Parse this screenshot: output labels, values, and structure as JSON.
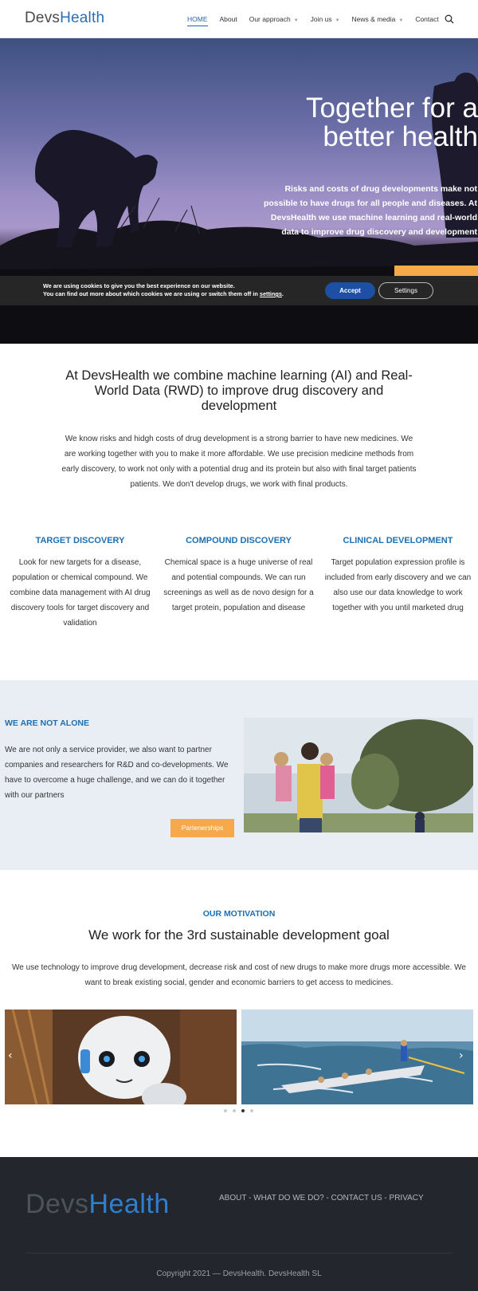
{
  "header": {
    "logo": {
      "part1": "Devs",
      "part2": "Health"
    },
    "nav": [
      {
        "label": "HOME",
        "active": true,
        "dropdown": false
      },
      {
        "label": "About",
        "active": false,
        "dropdown": false
      },
      {
        "label": "Our approach",
        "active": false,
        "dropdown": true
      },
      {
        "label": "Join us",
        "active": false,
        "dropdown": true
      },
      {
        "label": "News & media",
        "active": false,
        "dropdown": true
      },
      {
        "label": "Contact",
        "active": false,
        "dropdown": false
      }
    ],
    "search_icon": "search-icon"
  },
  "hero": {
    "title": "Together for a better health",
    "text": "Risks and costs of drug developments make not possible to have drugs for all people and diseases. At DevsHealth we use machine learning and real-world data to improve drug discovery and development"
  },
  "cookie": {
    "line1": "We are using cookies to give you the best experience on our website.",
    "line2_pre": "You can find out more about which cookies we are using or switch them off in ",
    "line2_link": "settings",
    "line2_post": ".",
    "accept": "Accept",
    "settings": "Settings"
  },
  "intro": {
    "title": "At DevsHealth we combine machine learning (AI) and Real-World Data (RWD) to improve drug discovery and development",
    "text": "We know risks and hidgh costs of drug development is a strong barrier to have new medicines. We are working together with you to make it more affordable. We use precision medicine methods from early discovery, to work not only with a potential drug and its protein but also with final target patients patients. We don't develop drugs, we work with final products."
  },
  "columns": [
    {
      "title": "TARGET DISCOVERY",
      "text": "Look for new targets for a disease, population or chemical compound. We combine data management with AI drug discovery tools for target discovery and validation"
    },
    {
      "title": "COMPOUND DISCOVERY",
      "text": "Chemical space is a huge universe of real and potential compounds. We can run screenings as well as de novo design for a target protein, population and disease"
    },
    {
      "title": "CLINICAL DEVELOPMENT",
      "text": "Target population expression profile is included from early discovery and we can also use our data knowledge to work together with you until marketed drug"
    }
  ],
  "alone": {
    "title": "WE ARE NOT ALONE",
    "text": "We are not only a service provider, we also want to partner companies and researchers for R&D and co-developments. We have to overcome a huge challenge, and we can do it together with our partners",
    "button": "Partenerships"
  },
  "motivation": {
    "label": "OUR MOTIVATION",
    "title": "We work for the 3rd sustainable development goal",
    "text": "We use technology to improve drug development, decrease risk and cost of new drugs to make more drugs more accessible. We want to break existing social, gender and economic barriers to get access to medicines.",
    "prev": "‹",
    "next": "›",
    "slide_count": 4,
    "active_slide": 3
  },
  "footer": {
    "logo": {
      "part1": "Devs",
      "part2": "Health"
    },
    "links": "ABOUT - WHAT DO WE DO? - CONTACT US - PRIVACY",
    "copyright": "Copyright 2021 — DevsHealth. DevsHealth SL"
  },
  "colors": {
    "brand_blue": "#1e6fb0",
    "accent_orange": "#f5a94a",
    "footer_bg": "#23262d",
    "section_bg": "#e9eef5"
  }
}
